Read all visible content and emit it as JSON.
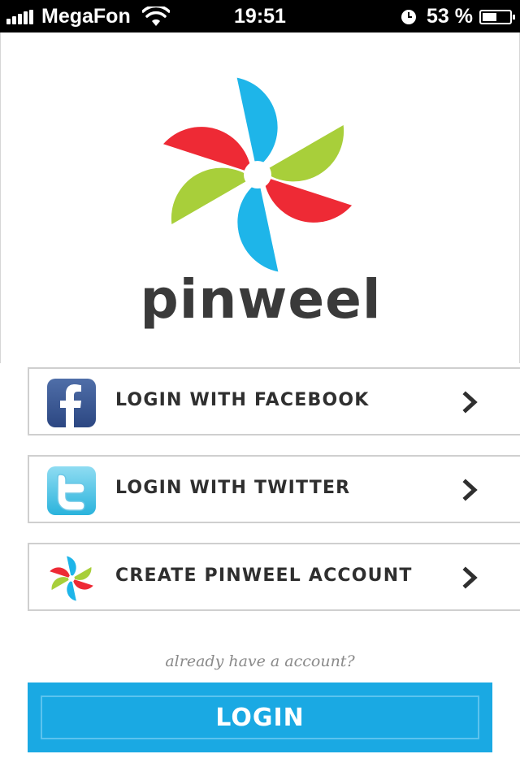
{
  "status_bar": {
    "carrier": "MegaFon",
    "time": "19:51",
    "battery_percent": "53 %",
    "battery_level": 0.53
  },
  "brand": {
    "name": "pinweel",
    "colors": {
      "red": "#ee2a35",
      "blue": "#1eb5e9",
      "green": "#a8cf3a",
      "dark": "#3a3a3a"
    }
  },
  "options": [
    {
      "label": "LOGIN WITH FACEBOOK",
      "icon": "facebook-icon"
    },
    {
      "label": "LOGIN WITH TWITTER",
      "icon": "twitter-icon"
    },
    {
      "label": "CREATE PINWEEL ACCOUNT",
      "icon": "pinweel-icon"
    }
  ],
  "login_prompt": "already have a account?",
  "login_button": "LOGIN"
}
